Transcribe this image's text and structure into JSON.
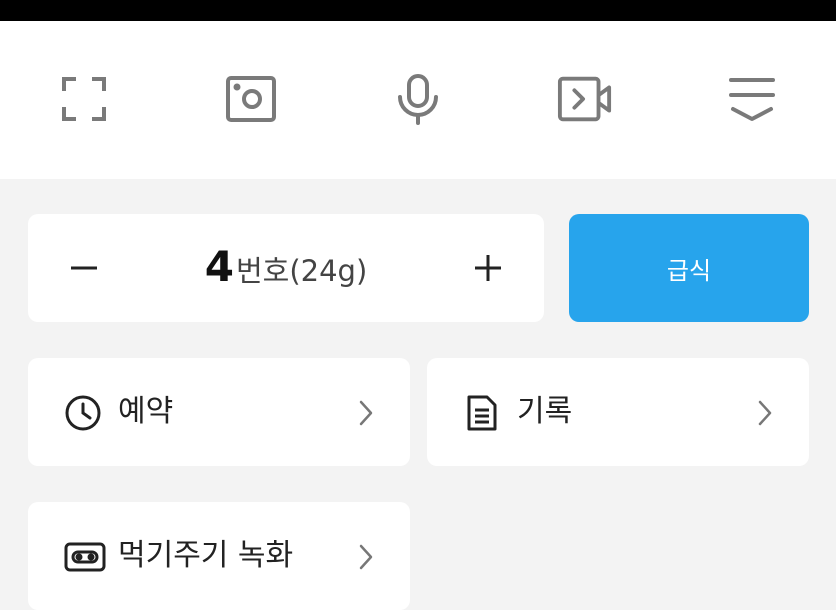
{
  "toolbar": {
    "icons": [
      "fullscreen-icon",
      "snapshot-icon",
      "microphone-icon",
      "video-record-icon",
      "collapse-icon"
    ]
  },
  "portion": {
    "minus_icon": "minus-icon",
    "number": "4",
    "unit": "번호",
    "weight": "(24g)",
    "plus_icon": "plus-icon"
  },
  "feed_button": {
    "label": "급식",
    "color": "#27a4ec"
  },
  "menu": {
    "reserve": {
      "label": "예약",
      "icon": "clock-icon"
    },
    "records": {
      "label": "기록",
      "icon": "document-icon"
    },
    "recording": {
      "label": "먹기주기 녹화",
      "icon": "cassette-icon"
    }
  }
}
